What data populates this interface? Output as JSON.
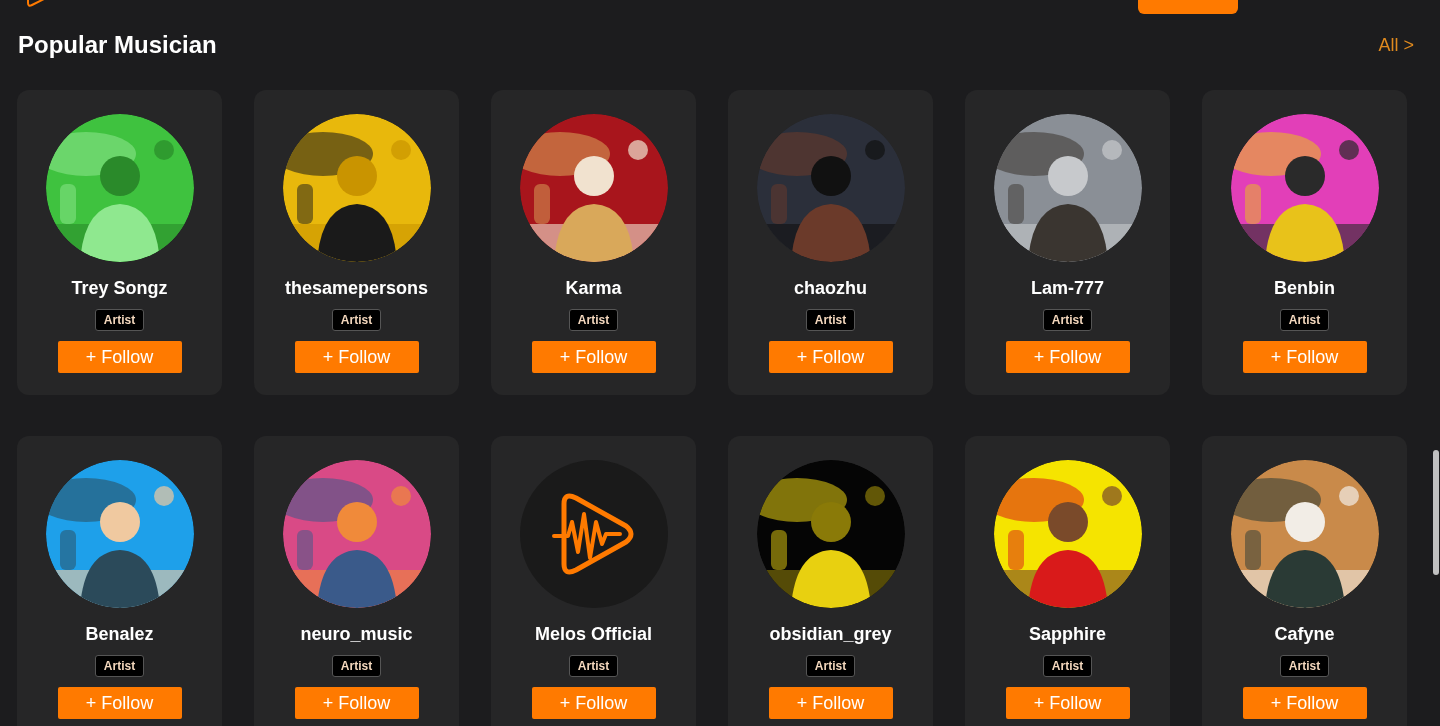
{
  "section": {
    "title": "Popular Musician",
    "all_link": "All >"
  },
  "musicians": [
    {
      "name": "Trey Songz",
      "role": "Artist",
      "follow": "+ Follow"
    },
    {
      "name": "thesamepersons",
      "role": "Artist",
      "follow": "+ Follow"
    },
    {
      "name": "Karma",
      "role": "Artist",
      "follow": "+ Follow"
    },
    {
      "name": "chaozhu",
      "role": "Artist",
      "follow": "+ Follow"
    },
    {
      "name": "Lam-777",
      "role": "Artist",
      "follow": "+ Follow"
    },
    {
      "name": "Benbin",
      "role": "Artist",
      "follow": "+ Follow"
    },
    {
      "name": "Benalez",
      "role": "Artist",
      "follow": "+ Follow"
    },
    {
      "name": "neuro_music",
      "role": "Artist",
      "follow": "+ Follow"
    },
    {
      "name": "Melos Official",
      "role": "Artist",
      "follow": "+ Follow",
      "avatar": {
        "kind": "logo"
      }
    },
    {
      "name": "obsidian_grey",
      "role": "Artist",
      "follow": "+ Follow"
    },
    {
      "name": "Sapphire",
      "role": "Artist",
      "follow": "+ Follow"
    },
    {
      "name": "Cafyne",
      "role": "Artist",
      "follow": "+ Follow"
    }
  ]
}
